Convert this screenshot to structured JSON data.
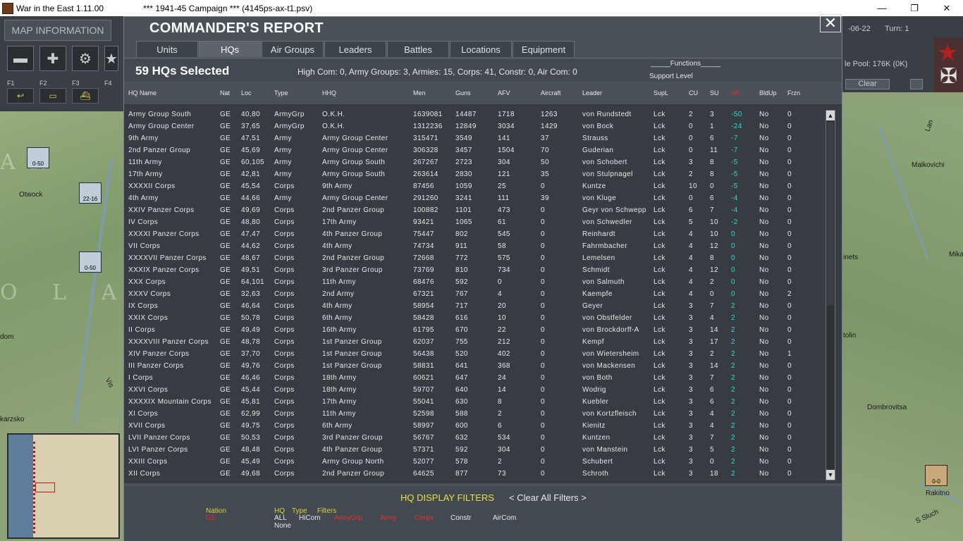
{
  "window": {
    "title": "War in the East 1.11.00",
    "scenario": "***   1941-45 Campaign   ***   (4145ps-ax-t1.psv)",
    "min_glyph": "—",
    "max_glyph": "❐",
    "close_glyph": "✕"
  },
  "left_panel": {
    "map_info_label": "MAP INFORMATION",
    "fkeys": [
      "F1",
      "F2",
      "F3",
      "F4"
    ]
  },
  "right_panel": {
    "date": "-06-22",
    "turn": "Turn: 1",
    "pool": "le Pool: 176K (0K)",
    "clear_label": "Clear"
  },
  "map_labels": {
    "ar_letters": "AR",
    "olan": "O L A",
    "otwock": "Otwock",
    "dom": "dom",
    "karzsko": "karzsko",
    "malkovichi": "Malkovichi",
    "inets": "inets",
    "tolin": "tolin",
    "dombrovitsa": "Dombrovitsa",
    "rakitno": "Rakitno",
    "mika": "Mika",
    "lan": "Lan",
    "ssluch": "S Sluch",
    "vis": "Vis",
    "unit1": "0-50",
    "unit2": "22-16",
    "unit3": "0-50",
    "unit4": "0-0"
  },
  "dialog": {
    "title": "COMMANDER'S REPORT",
    "close_glyph": "✕",
    "tabs": [
      "Units",
      "HQs",
      "Air Groups",
      "Leaders",
      "Battles",
      "Locations",
      "Equipment"
    ],
    "active_tab": "HQs",
    "selected_count": "59 HQs Selected",
    "stats": "High Com: 0, Army Groups: 3, Armies: 15, Corps: 41, Constr: 0, Air Com: 0",
    "functions_label": "_____Functions_____",
    "support_level_label": "Support Level",
    "columns": [
      "HQ Name",
      "Nat",
      "Loc",
      "Type",
      "HHQ",
      "Men",
      "Guns",
      "AFV",
      "Aircraft",
      "Leader",
      "SupL",
      "CU",
      "SU",
      "SP",
      "BldUp",
      "Frzn"
    ],
    "rows": [
      [
        "Army Group South",
        "GE",
        "40,80",
        "ArmyGrp",
        "O.K.H.",
        "1639081",
        "14487",
        "1718",
        "1263",
        "von Rundstedt",
        "Lck",
        "2",
        "3",
        "-50",
        "No",
        "0"
      ],
      [
        "Army Group Center",
        "GE",
        "37,65",
        "ArmyGrp",
        "O.K.H.",
        "1312236",
        "12849",
        "3034",
        "1429",
        "von Bock",
        "Lck",
        "0",
        "1",
        "-24",
        "No",
        "0"
      ],
      [
        "9th Army",
        "GE",
        "47,51",
        "Army",
        "Army Group Center",
        "315471",
        "3549",
        "141",
        "37",
        "Strauss",
        "Lck",
        "0",
        "6",
        "-7",
        "No",
        "0"
      ],
      [
        "2nd Panzer Group",
        "GE",
        "45,69",
        "Army",
        "Army Group Center",
        "306328",
        "3457",
        "1504",
        "70",
        "Guderian",
        "Lck",
        "0",
        "11",
        "-7",
        "No",
        "0"
      ],
      [
        "11th Army",
        "GE",
        "60,105",
        "Army",
        "Army Group South",
        "267267",
        "2723",
        "304",
        "50",
        "von Schobert",
        "Lck",
        "3",
        "8",
        "-5",
        "No",
        "0"
      ],
      [
        "17th Army",
        "GE",
        "42,81",
        "Army",
        "Army Group South",
        "263614",
        "2830",
        "121",
        "35",
        "von Stulpnagel",
        "Lck",
        "2",
        "8",
        "-5",
        "No",
        "0"
      ],
      [
        "XXXXII Corps",
        "GE",
        "45,54",
        "Corps",
        "9th Army",
        "87456",
        "1059",
        "25",
        "0",
        "Kuntze",
        "Lck",
        "10",
        "0",
        "-5",
        "No",
        "0"
      ],
      [
        "4th Army",
        "GE",
        "44,66",
        "Army",
        "Army Group Center",
        "291260",
        "3241",
        "111",
        "39",
        "von Kluge",
        "Lck",
        "0",
        "6",
        "-4",
        "No",
        "0"
      ],
      [
        "XXIV Panzer Corps",
        "GE",
        "49,69",
        "Corps",
        "2nd Panzer Group",
        "100882",
        "1101",
        "473",
        "0",
        "Geyr von Schwepp",
        "Lck",
        "6",
        "7",
        "-4",
        "No",
        "0"
      ],
      [
        "IV Corps",
        "GE",
        "48,80",
        "Corps",
        "17th Army",
        "93421",
        "1065",
        "61",
        "0",
        "von Schwedler",
        "Lck",
        "5",
        "10",
        "-2",
        "No",
        "0"
      ],
      [
        "XXXXI Panzer Corps",
        "GE",
        "47,47",
        "Corps",
        "4th Panzer Group",
        "75447",
        "802",
        "545",
        "0",
        "Reinhardt",
        "Lck",
        "4",
        "10",
        "0",
        "No",
        "0"
      ],
      [
        "VII Corps",
        "GE",
        "44,62",
        "Corps",
        "4th Army",
        "74734",
        "911",
        "58",
        "0",
        "Fahrmbacher",
        "Lck",
        "4",
        "12",
        "0",
        "No",
        "0"
      ],
      [
        "XXXXVII Panzer Corps",
        "GE",
        "48,67",
        "Corps",
        "2nd Panzer Group",
        "72668",
        "772",
        "575",
        "0",
        "Lemelsen",
        "Lck",
        "4",
        "8",
        "0",
        "No",
        "0"
      ],
      [
        "XXXIX Panzer Corps",
        "GE",
        "49,51",
        "Corps",
        "3rd Panzer Group",
        "73769",
        "810",
        "734",
        "0",
        "Schmidt",
        "Lck",
        "4",
        "12",
        "0",
        "No",
        "0"
      ],
      [
        "XXX Corps",
        "GE",
        "64,101",
        "Corps",
        "11th Army",
        "68476",
        "592",
        "0",
        "0",
        "von Salmuth",
        "Lck",
        "4",
        "2",
        "0",
        "No",
        "0"
      ],
      [
        "XXXV Corps",
        "GE",
        "32,63",
        "Corps",
        "2nd Army",
        "67321",
        "767",
        "4",
        "0",
        "Kaempfe",
        "Lck",
        "4",
        "0",
        "0",
        "No",
        "2"
      ],
      [
        "IX Corps",
        "GE",
        "46,64",
        "Corps",
        "4th Army",
        "58954",
        "717",
        "20",
        "0",
        "Geyer",
        "Lck",
        "3",
        "7",
        "2",
        "No",
        "0"
      ],
      [
        "XXIX Corps",
        "GE",
        "50,78",
        "Corps",
        "6th Army",
        "58428",
        "616",
        "10",
        "0",
        "von Obstfelder",
        "Lck",
        "3",
        "4",
        "2",
        "No",
        "0"
      ],
      [
        "II Corps",
        "GE",
        "49,49",
        "Corps",
        "16th Army",
        "61795",
        "670",
        "22",
        "0",
        "von Brockdorff-A",
        "Lck",
        "3",
        "14",
        "2",
        "No",
        "0"
      ],
      [
        "XXXXVIII Panzer Corps",
        "GE",
        "48,78",
        "Corps",
        "1st Panzer Group",
        "62037",
        "755",
        "212",
        "0",
        "Kempf",
        "Lck",
        "3",
        "17",
        "2",
        "No",
        "0"
      ],
      [
        "XIV Panzer Corps",
        "GE",
        "37,70",
        "Corps",
        "1st Panzer Group",
        "56438",
        "520",
        "402",
        "0",
        "von Wietersheim",
        "Lck",
        "3",
        "2",
        "2",
        "No",
        "1"
      ],
      [
        "III Panzer Corps",
        "GE",
        "49,76",
        "Corps",
        "1st Panzer Group",
        "58831",
        "641",
        "368",
        "0",
        "von Mackensen",
        "Lck",
        "3",
        "14",
        "2",
        "No",
        "0"
      ],
      [
        "I Corps",
        "GE",
        "46,46",
        "Corps",
        "18th Army",
        "60621",
        "647",
        "24",
        "0",
        "von Both",
        "Lck",
        "3",
        "7",
        "2",
        "No",
        "0"
      ],
      [
        "XXVI Corps",
        "GE",
        "45,44",
        "Corps",
        "18th Army",
        "59707",
        "640",
        "14",
        "0",
        "Wodrig",
        "Lck",
        "3",
        "6",
        "2",
        "No",
        "0"
      ],
      [
        "XXXXIX Mountain Corps",
        "GE",
        "45,81",
        "Corps",
        "17th Army",
        "55041",
        "630",
        "8",
        "0",
        "Kuebler",
        "Lck",
        "3",
        "6",
        "2",
        "No",
        "0"
      ],
      [
        "XI Corps",
        "GE",
        "62,99",
        "Corps",
        "11th Army",
        "52598",
        "588",
        "2",
        "0",
        "von Kortzfleisch",
        "Lck",
        "3",
        "4",
        "2",
        "No",
        "0"
      ],
      [
        "XVII Corps",
        "GE",
        "49,75",
        "Corps",
        "6th Army",
        "58997",
        "600",
        "6",
        "0",
        "Kienitz",
        "Lck",
        "3",
        "4",
        "2",
        "No",
        "0"
      ],
      [
        "LVII Panzer Corps",
        "GE",
        "50,53",
        "Corps",
        "3rd Panzer Group",
        "56767",
        "632",
        "534",
        "0",
        "Kuntzen",
        "Lck",
        "3",
        "7",
        "2",
        "No",
        "0"
      ],
      [
        "LVI Panzer Corps",
        "GE",
        "48,48",
        "Corps",
        "4th Panzer Group",
        "57371",
        "592",
        "304",
        "0",
        "von Manstein",
        "Lck",
        "3",
        "5",
        "2",
        "No",
        "0"
      ],
      [
        "XXIII Corps",
        "GE",
        "45,49",
        "Corps",
        "Army Group North",
        "52077",
        "578",
        "2",
        "0",
        "Schubert",
        "Lck",
        "3",
        "0",
        "2",
        "No",
        "0"
      ],
      [
        "XII Corps",
        "GE",
        "49,68",
        "Corps",
        "2nd Panzer Group",
        "64625",
        "877",
        "73",
        "0",
        "Schroth",
        "Lck",
        "3",
        "18",
        "2",
        "No",
        "0"
      ]
    ],
    "scroll_up_glyph": "▲",
    "scroll_down_glyph": "▼",
    "filters": {
      "title": "HQ DISPLAY FILTERS",
      "clear_all": "< Clear All Filters >",
      "nation_label": "Nation",
      "nation_value": "GE",
      "hq_label": "HQ",
      "type_label": "Type",
      "filters_label": "Filters",
      "all": "ALL",
      "none": "None",
      "hicom": "HiCom",
      "armygrp": "ArmyGrp",
      "army": "Army",
      "corps": "Corps",
      "constr": "Constr",
      "aircom": "AirCom"
    }
  },
  "colors": {
    "dialog_bg": "#4b5158",
    "table_bg": "#373c42",
    "sp_color": "#30d8d0",
    "filter_title": "#e8e040",
    "filter_red": "#e03030"
  }
}
